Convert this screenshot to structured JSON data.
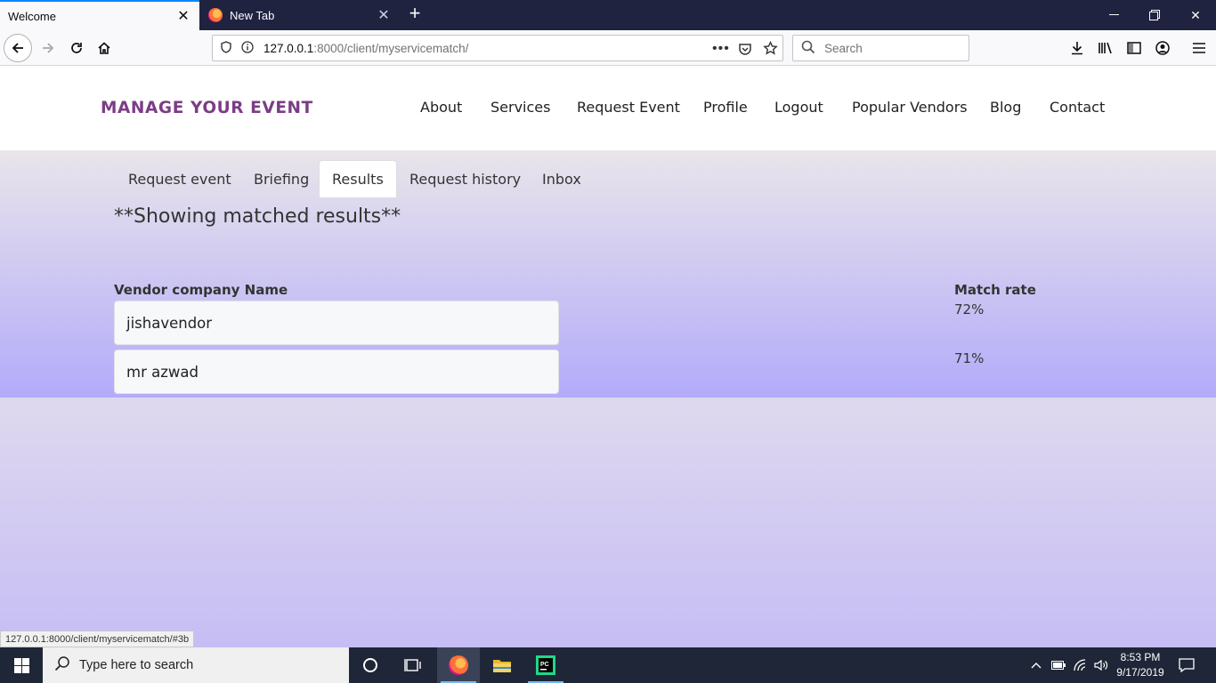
{
  "browser": {
    "tabs": [
      {
        "title": "Welcome",
        "active": true
      },
      {
        "title": "New Tab",
        "active": false
      }
    ],
    "url_host": "127.0.0.1",
    "url_path": ":8000/client/myservicematch/",
    "search_placeholder": "Search",
    "status_url": "127.0.0.1:8000/client/myservicematch/#3b"
  },
  "site": {
    "brand": "MANAGE YOUR EVENT",
    "nav": [
      "About",
      "Services",
      "Request Event",
      "Profile",
      "Logout",
      "Popular Vendors",
      "Blog",
      "Contact"
    ],
    "brand_color": "#7b3d86"
  },
  "subtabs": {
    "items": [
      "Request event",
      "Briefing",
      "Results",
      "Request history",
      "Inbox"
    ],
    "active": "Results"
  },
  "results": {
    "heading": "**Showing matched results**",
    "col_vendor": "Vendor company Name",
    "col_rate": "Match rate",
    "rows": [
      {
        "vendor": "jishavendor",
        "rate": "72%"
      },
      {
        "vendor": "mr azwad",
        "rate": "71%"
      }
    ]
  },
  "taskbar": {
    "search_placeholder": "Type here to search",
    "time": "8:53 PM",
    "date": "9/17/2019"
  }
}
